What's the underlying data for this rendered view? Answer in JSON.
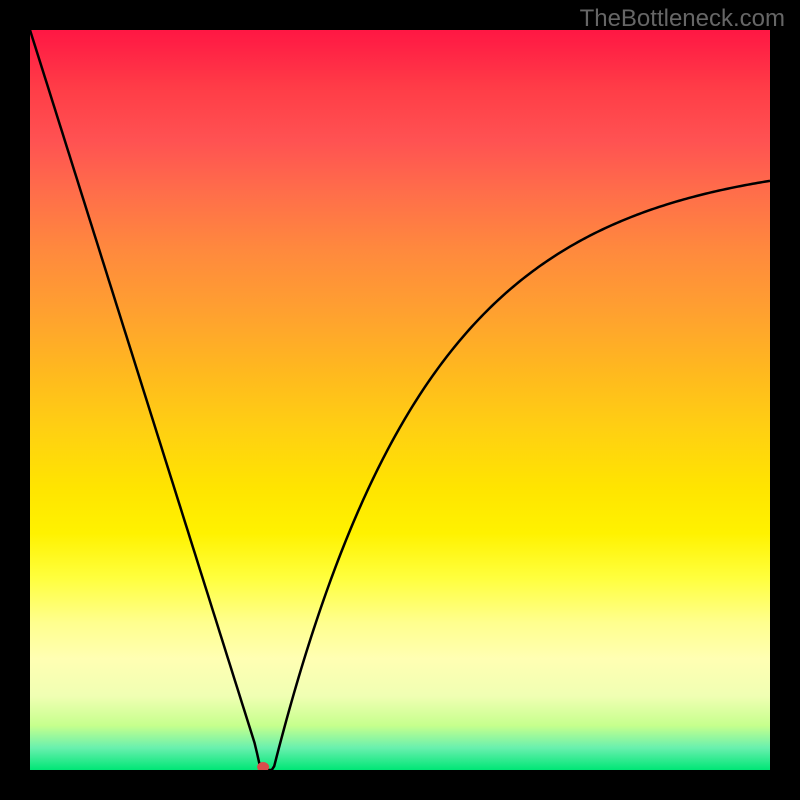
{
  "watermark": "TheBottleneck.com",
  "chart_data": {
    "type": "line",
    "title": "",
    "xlabel": "",
    "ylabel": "",
    "xlim": [
      0,
      100
    ],
    "ylim": [
      0,
      100
    ],
    "x": [
      0,
      5,
      10,
      15,
      20,
      25,
      28,
      30,
      31,
      32,
      33,
      34,
      36,
      40,
      45,
      50,
      55,
      60,
      65,
      70,
      75,
      80,
      85,
      90,
      95,
      100
    ],
    "values": [
      100,
      82,
      65,
      48,
      32,
      16,
      6,
      2,
      0,
      0,
      0,
      2,
      6,
      15,
      28,
      40,
      50,
      58,
      65,
      70,
      74,
      77,
      79,
      81,
      82,
      83
    ],
    "minimum_point": {
      "x": 31.5,
      "y": 0
    },
    "gradient": {
      "top": "red",
      "bottom": "green",
      "description": "vertical gradient from red through orange, yellow to green"
    },
    "marker": {
      "x": 31.5,
      "y": 0,
      "color": "#d84c4c"
    }
  }
}
